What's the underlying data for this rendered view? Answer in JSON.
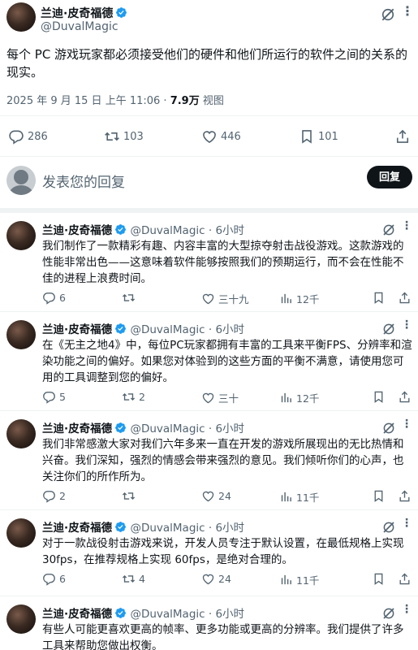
{
  "main_post": {
    "author_name": "兰迪·皮奇福德",
    "handle": "@DuvalMagic",
    "text": "每个 PC 游戏玩家都必须接受他们的硬件和他们所运行的软件之间的关系的现实。",
    "timestamp": "2025 年 9 月 15 日 上午 11:06 · ",
    "views_count": "7.9万",
    "views_label": " 视图",
    "stats": {
      "replies": "286",
      "reposts": "103",
      "likes": "446",
      "views": "101"
    }
  },
  "composer": {
    "placeholder": "发表您的回复",
    "button_label": "回复"
  },
  "replies": [
    {
      "author_name": "兰迪·皮奇福德",
      "handle_time": "@DuvalMagic · 6小时",
      "text": "我们制作了一款精彩有趣、内容丰富的大型掠夺射击战役游戏。这款游戏的性能非常出色——这意味着软件能够按照我们的预期运行，而不会在性能不佳的进程上浪费时间。",
      "replies": "6",
      "reposts": "",
      "likes": "三十九",
      "views": "12千"
    },
    {
      "author_name": "兰迪·皮奇福德",
      "handle_time": "@DuvalMagic · 6小时",
      "text": "在《无主之地4》中，每位PC玩家都拥有丰富的工具来平衡FPS、分辨率和渲染功能之间的偏好。如果您对体验到的这些方面的平衡不满意，请使用您可用的工具调整到您的偏好。",
      "replies": "5",
      "reposts": "2",
      "likes": "三十",
      "views": "12千"
    },
    {
      "author_name": "兰迪·皮奇福德",
      "handle_time": "@DuvalMagic · 6小时",
      "text": "我们非常感激大家对我们六年多来一直在开发的游戏所展现出的无比热情和兴奋。我们深知，强烈的情感会带来强烈的意见。我们倾听你们的心声，也关注你们的所作所为。",
      "replies": "2",
      "reposts": "",
      "likes": "24",
      "views": "11千"
    },
    {
      "author_name": "兰迪·皮奇福德",
      "handle_time": "@DuvalMagic · 6小时",
      "text": "对于一款战役射击游戏来说，开发人员专注于默认设置，在最低规格上实现30fps，在推荐规格上实现 60fps，是绝对合理的。",
      "replies": "6",
      "reposts": "4",
      "likes": "24",
      "views": "11千"
    },
    {
      "author_name": "兰迪·皮奇福德",
      "handle_time": "@DuvalMagic · 6小时",
      "text": "有些人可能更喜欢更高的帧率、更多功能或更高的分辨率。我们提供了许多工具来帮助您做出权衡。"
    }
  ],
  "colors": {
    "accent": "#1d9bf0",
    "text": "#0f1419",
    "muted": "#536471"
  },
  "icons": [
    "verified-badge-icon",
    "grok-icon",
    "more-icon",
    "reply-icon",
    "repost-icon",
    "like-icon",
    "views-icon",
    "bookmark-icon",
    "share-icon"
  ]
}
